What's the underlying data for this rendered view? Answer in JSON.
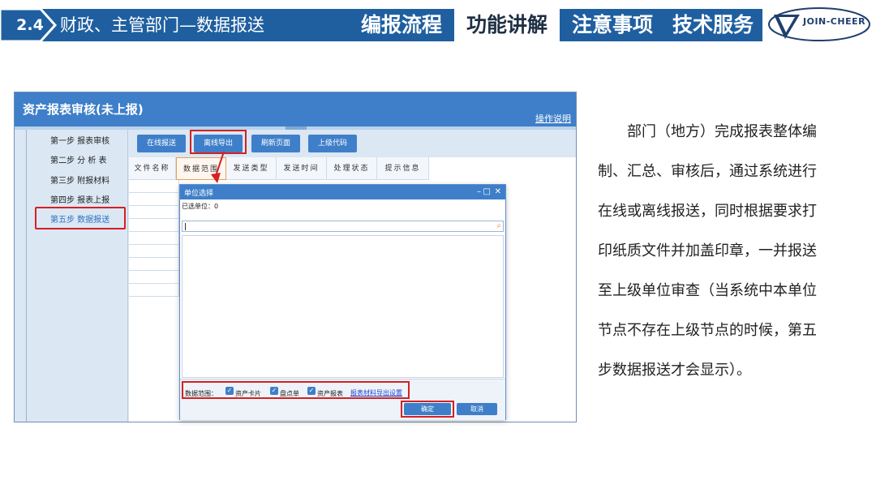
{
  "header": {
    "section_number": "2.4",
    "section_title": "财政、主管部门—数据报送",
    "nav": [
      {
        "label": "编报流程",
        "active": false
      },
      {
        "label": "功能讲解",
        "active": true
      },
      {
        "label": "注意事项",
        "active": false
      },
      {
        "label": "技术服务",
        "active": false
      }
    ],
    "logo_text": "JOIN-CHEER",
    "colors": {
      "bar": "#1f5fa0",
      "accent": "#3f7fc9",
      "highlight": "#d42121"
    }
  },
  "app": {
    "title": "资产报表审核(未上报)",
    "help_link": "操作说明",
    "steps": [
      {
        "label": "第一步 报表审核",
        "active": false
      },
      {
        "label": "第二步 分 析 表",
        "active": false
      },
      {
        "label": "第三步 附报材料",
        "active": false
      },
      {
        "label": "第四步 报表上报",
        "active": false
      },
      {
        "label": "第五步 数据报送",
        "active": true
      }
    ],
    "toolbar": [
      {
        "label": "在线报送"
      },
      {
        "label": "离线导出"
      },
      {
        "label": "刷新页面"
      },
      {
        "label": "上级代码"
      }
    ],
    "columns": [
      "文件名称",
      "数据范围",
      "发送类型",
      "发送时间",
      "处理状态",
      "提示信息"
    ]
  },
  "dialog": {
    "title": "单位选择",
    "controls": {
      "minimize": "–",
      "maximize": "□",
      "close": "✕"
    },
    "selected_units": "已选单位：0",
    "search_value": "",
    "range_label": "数据范围：",
    "options": [
      {
        "label": "资产卡片",
        "checked": true
      },
      {
        "label": "盘点单",
        "checked": true
      },
      {
        "label": "资产报表",
        "checked": true
      }
    ],
    "export_settings_link": "报表材料导出设置",
    "ok_label": "确定",
    "cancel_label": "取消"
  },
  "description": {
    "lines": [
      "　　部门（地方）完成报表整体编",
      "制、汇总、审核后，通过系统进行",
      "在线或离线报送，同时根据要求打",
      "印纸质文件并加盖印章，一并报送",
      "至上级单位审查（当系统中本单位",
      "节点不存在上级节点的时候，第五",
      "步数据报送才会显示）。"
    ]
  }
}
